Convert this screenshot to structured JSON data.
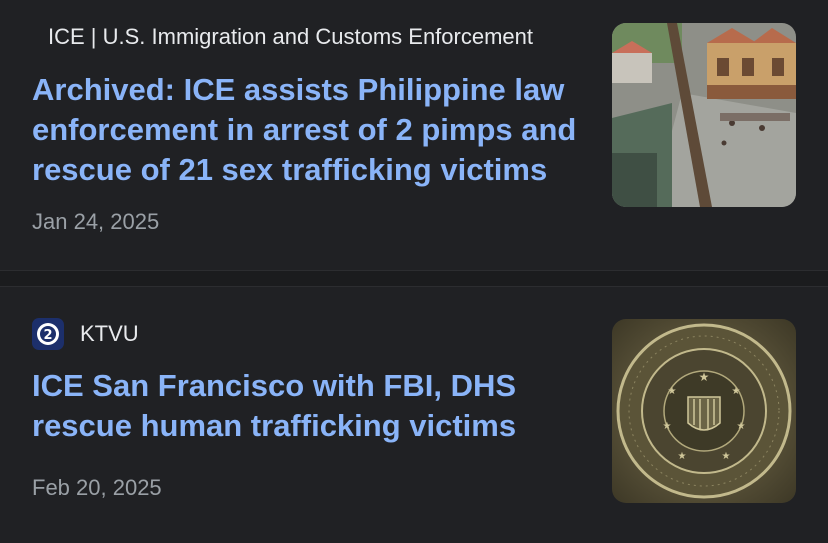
{
  "articles": [
    {
      "source": "ICE | U.S. Immigration and Customs Enforcement",
      "headline": "Archived: ICE assists Philippine law enforcement in arrest of 2 pimps and rescue of 21 sex trafficking victims",
      "date": "Jan 24, 2025",
      "thumbnail": "street-photo"
    },
    {
      "source": "KTVU",
      "favicon": "ktvu-logo-icon",
      "headline": "ICE San Francisco with FBI, DHS rescue human trafficking victims",
      "date": "Feb 20, 2025",
      "thumbnail": "fbi-seal"
    }
  ],
  "colors": {
    "background": "#202124",
    "headline": "#8ab4f8",
    "source": "#e8eaed",
    "date": "#9aa0a6"
  }
}
